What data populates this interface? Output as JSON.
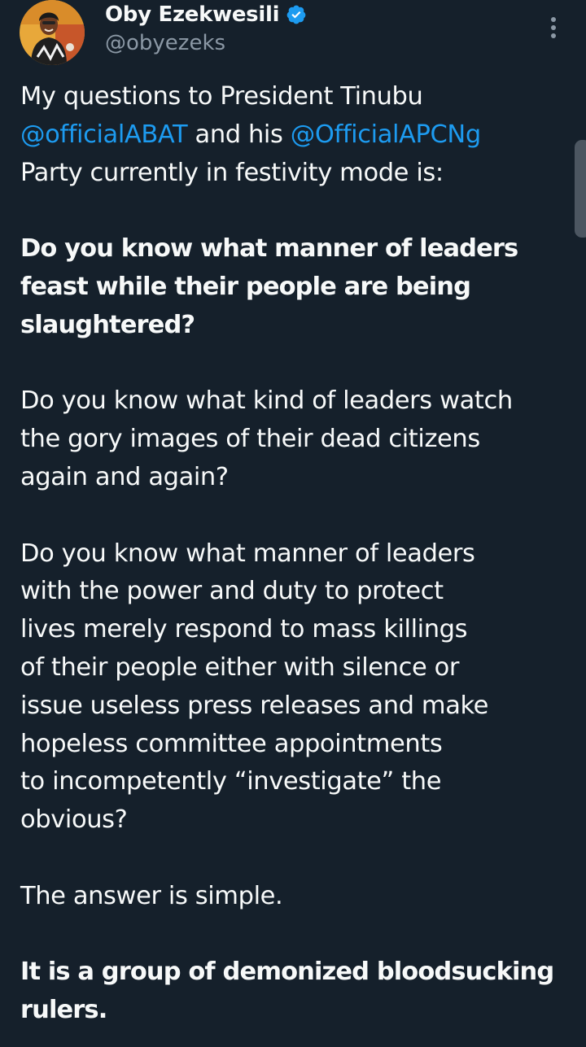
{
  "author": {
    "display_name": "Oby Ezekwesili",
    "handle": "@obyezeks",
    "verified": true
  },
  "icons": {
    "verified": "verified-badge-icon",
    "more": "more-vertical-icon"
  },
  "colors": {
    "background": "#15202b",
    "text": "#f7f9f9",
    "secondary": "#8b98a5",
    "link": "#1d9bf0"
  },
  "tweet": {
    "p1_line1": "My questions to President Tinubu",
    "mention1": "@officialABAT",
    "p1_mid": " and his ",
    "mention2": "@OfficialAPCNg",
    "p1_line3": "Party currently in festivity mode is:",
    "p2_lines": [
      "Do you know what manner of leaders",
      "feast while their people are being",
      "slaughtered?"
    ],
    "p3_lines": [
      "Do you know what kind of leaders watch",
      "the gory images of their dead citizens",
      "again and again?"
    ],
    "p4_lines": [
      "Do you know what manner of leaders",
      "with the power and duty to protect",
      "lives merely respond to mass killings",
      "of their people either with silence or",
      "issue useless press releases and make",
      "hopeless committee appointments",
      "to incompetently “investigate” the",
      "obvious?"
    ],
    "p5": "The answer is simple.",
    "p6_lines": [
      "It is a group of demonized bloodsucking",
      "rulers."
    ]
  }
}
